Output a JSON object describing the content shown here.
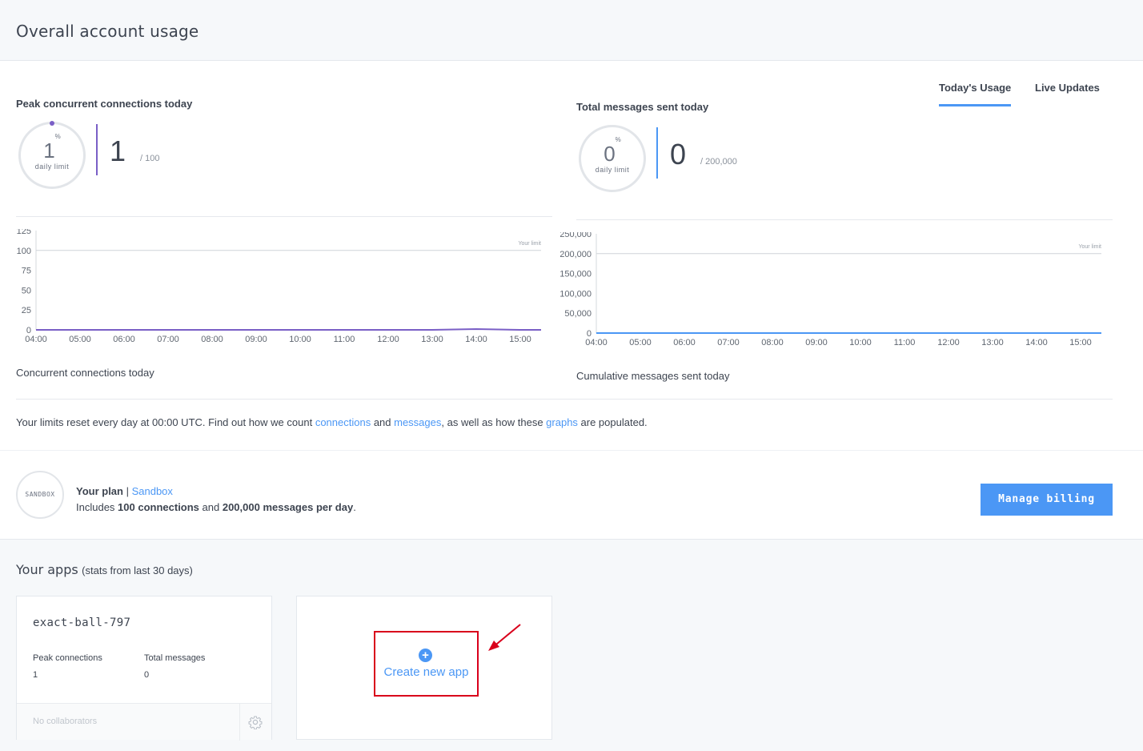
{
  "header": {
    "title": "Overall account usage"
  },
  "tabs": [
    {
      "label": "Today's Usage",
      "active": true
    },
    {
      "label": "Live Updates",
      "active": false
    }
  ],
  "connections": {
    "title": "Peak concurrent connections today",
    "percent": "1",
    "percent_sign": "%",
    "percent_sub": "daily limit",
    "value": "1",
    "limit": "/ 100",
    "caption": "Concurrent connections today",
    "accent": "#7a5fc6"
  },
  "messages": {
    "title": "Total messages sent today",
    "percent": "0",
    "percent_sign": "%",
    "percent_sub": "daily limit",
    "value": "0",
    "limit": "/ 200,000",
    "caption": "Cumulative messages sent today",
    "accent": "#4b97f5"
  },
  "chart_data": [
    {
      "type": "line",
      "x": [
        "04:00",
        "05:00",
        "06:00",
        "07:00",
        "08:00",
        "09:00",
        "10:00",
        "11:00",
        "12:00",
        "13:00",
        "14:00",
        "15:00"
      ],
      "y_ticks": [
        "125",
        "100",
        "75",
        "50",
        "25",
        "0"
      ],
      "ylim": [
        0,
        125
      ],
      "series": [
        {
          "values": [
            0,
            0,
            0,
            0,
            0,
            0,
            0,
            0,
            0,
            0,
            1,
            0
          ]
        }
      ],
      "limit_value": 100,
      "limit_label": "Your limit",
      "color": "#7a5fc6"
    },
    {
      "type": "line",
      "x": [
        "04:00",
        "05:00",
        "06:00",
        "07:00",
        "08:00",
        "09:00",
        "10:00",
        "11:00",
        "12:00",
        "13:00",
        "14:00",
        "15:00"
      ],
      "y_ticks": [
        "250,000",
        "200,000",
        "150,000",
        "100,000",
        "50,000",
        "0"
      ],
      "ylim": [
        0,
        250000
      ],
      "series": [
        {
          "values": [
            0,
            0,
            0,
            0,
            0,
            0,
            0,
            0,
            0,
            0,
            0,
            0
          ]
        }
      ],
      "limit_value": 200000,
      "limit_label": "Your limit",
      "color": "#4b97f5"
    }
  ],
  "reset_note": {
    "part1": "Your limits reset every day at 00:00 UTC. Find out how we count ",
    "link1": "connections",
    "part2": " and ",
    "link2": "messages",
    "part3": ", as well as how these ",
    "link3": "graphs",
    "part4": " are populated."
  },
  "plan": {
    "badge": "SANDBOX",
    "your_plan": "Your plan",
    "sep": " | ",
    "plan_name": "Sandbox",
    "includes": "Includes ",
    "connections": "100 connections",
    "and": " and ",
    "messages": "200,000 messages per day",
    "end": ".",
    "billing_button": "Manage billing"
  },
  "apps": {
    "title": "Your apps",
    "subtitle": "(stats from last 30 days)",
    "items": [
      {
        "name": "exact-ball-797",
        "peak_label": "Peak connections",
        "peak_value": "1",
        "total_label": "Total messages",
        "total_value": "0",
        "collaborators": "No collaborators"
      }
    ],
    "create_label": "Create new app"
  }
}
